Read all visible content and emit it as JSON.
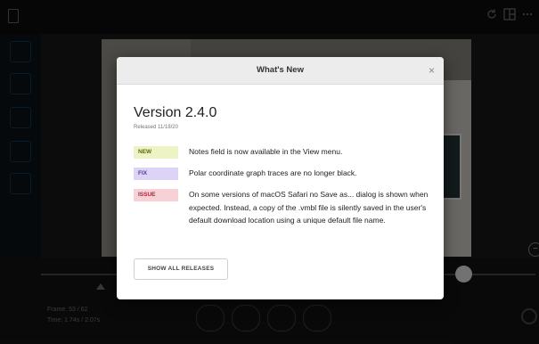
{
  "modal": {
    "title": "What's New",
    "close": "×",
    "version": "Version 2.4.0",
    "released": "Released 11/18/20",
    "notes": [
      {
        "badge": "NEW",
        "badge_color": "#5f6b00",
        "badge_bg": "#eef3c6",
        "text": "Notes field is now available in the View menu."
      },
      {
        "badge": "FIX",
        "badge_color": "#5a3aa0",
        "badge_bg": "#dcd3f6",
        "text": "Polar coordinate graph traces are no longer black."
      },
      {
        "badge": "ISSUE",
        "badge_color": "#b21f3a",
        "badge_bg": "#f7d1d6",
        "text": "On some versions of macOS Safari no Save as... dialog is shown when expected. Instead, a copy of the .vmbl file is silently saved in the user's default download location using a unique default file name."
      }
    ],
    "releases_button": "SHOW ALL RELEASES"
  },
  "frame_info": {
    "frame": "Frame: 53 / 62",
    "time": "Time: 1.74s / 2.07s"
  },
  "icons": {
    "close": "close-icon",
    "doc": "document-icon",
    "settings": "gear-icon"
  }
}
